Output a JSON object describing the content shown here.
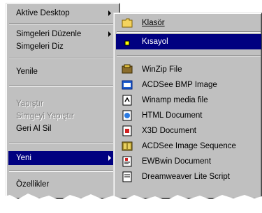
{
  "context_menu": {
    "items": [
      {
        "label": "Aktive Desktop",
        "has_submenu": true
      },
      {
        "label": "Simgeleri Düzenle",
        "has_submenu": true
      },
      {
        "label": "Simgeleri Diz"
      },
      {
        "label": "Yenile"
      },
      {
        "label": "Yapıştır",
        "disabled": true
      },
      {
        "label": "Simgeyi Yapıştır",
        "disabled": true
      },
      {
        "label": "Geri Al Sil"
      },
      {
        "label": "Yeni",
        "has_submenu": true,
        "selected": true
      },
      {
        "label": "Özellikler"
      }
    ]
  },
  "new_submenu": {
    "items": [
      {
        "label": "Klasör",
        "icon": "folder-icon"
      },
      {
        "label": "Kısayol",
        "icon": "shortcut-icon",
        "selected": true
      },
      {
        "label": "WinZip File",
        "icon": "winzip-icon"
      },
      {
        "label": "ACDSee BMP Image",
        "icon": "acdsee-bmp-icon"
      },
      {
        "label": "Winamp media file",
        "icon": "winamp-icon"
      },
      {
        "label": "HTML Document",
        "icon": "html-document-icon"
      },
      {
        "label": "X3D Document",
        "icon": "x3d-document-icon"
      },
      {
        "label": "ACDSee Image Sequence",
        "icon": "acdsee-sequence-icon"
      },
      {
        "label": "EWBwin Document",
        "icon": "ewbwin-document-icon"
      },
      {
        "label": "Dreamweaver Lite Script",
        "icon": "script-document-icon"
      }
    ]
  },
  "colors": {
    "menu_face": "#c0c0c0",
    "highlight": "#000080",
    "highlight_text": "#ffffff",
    "disabled_text": "#808080"
  }
}
